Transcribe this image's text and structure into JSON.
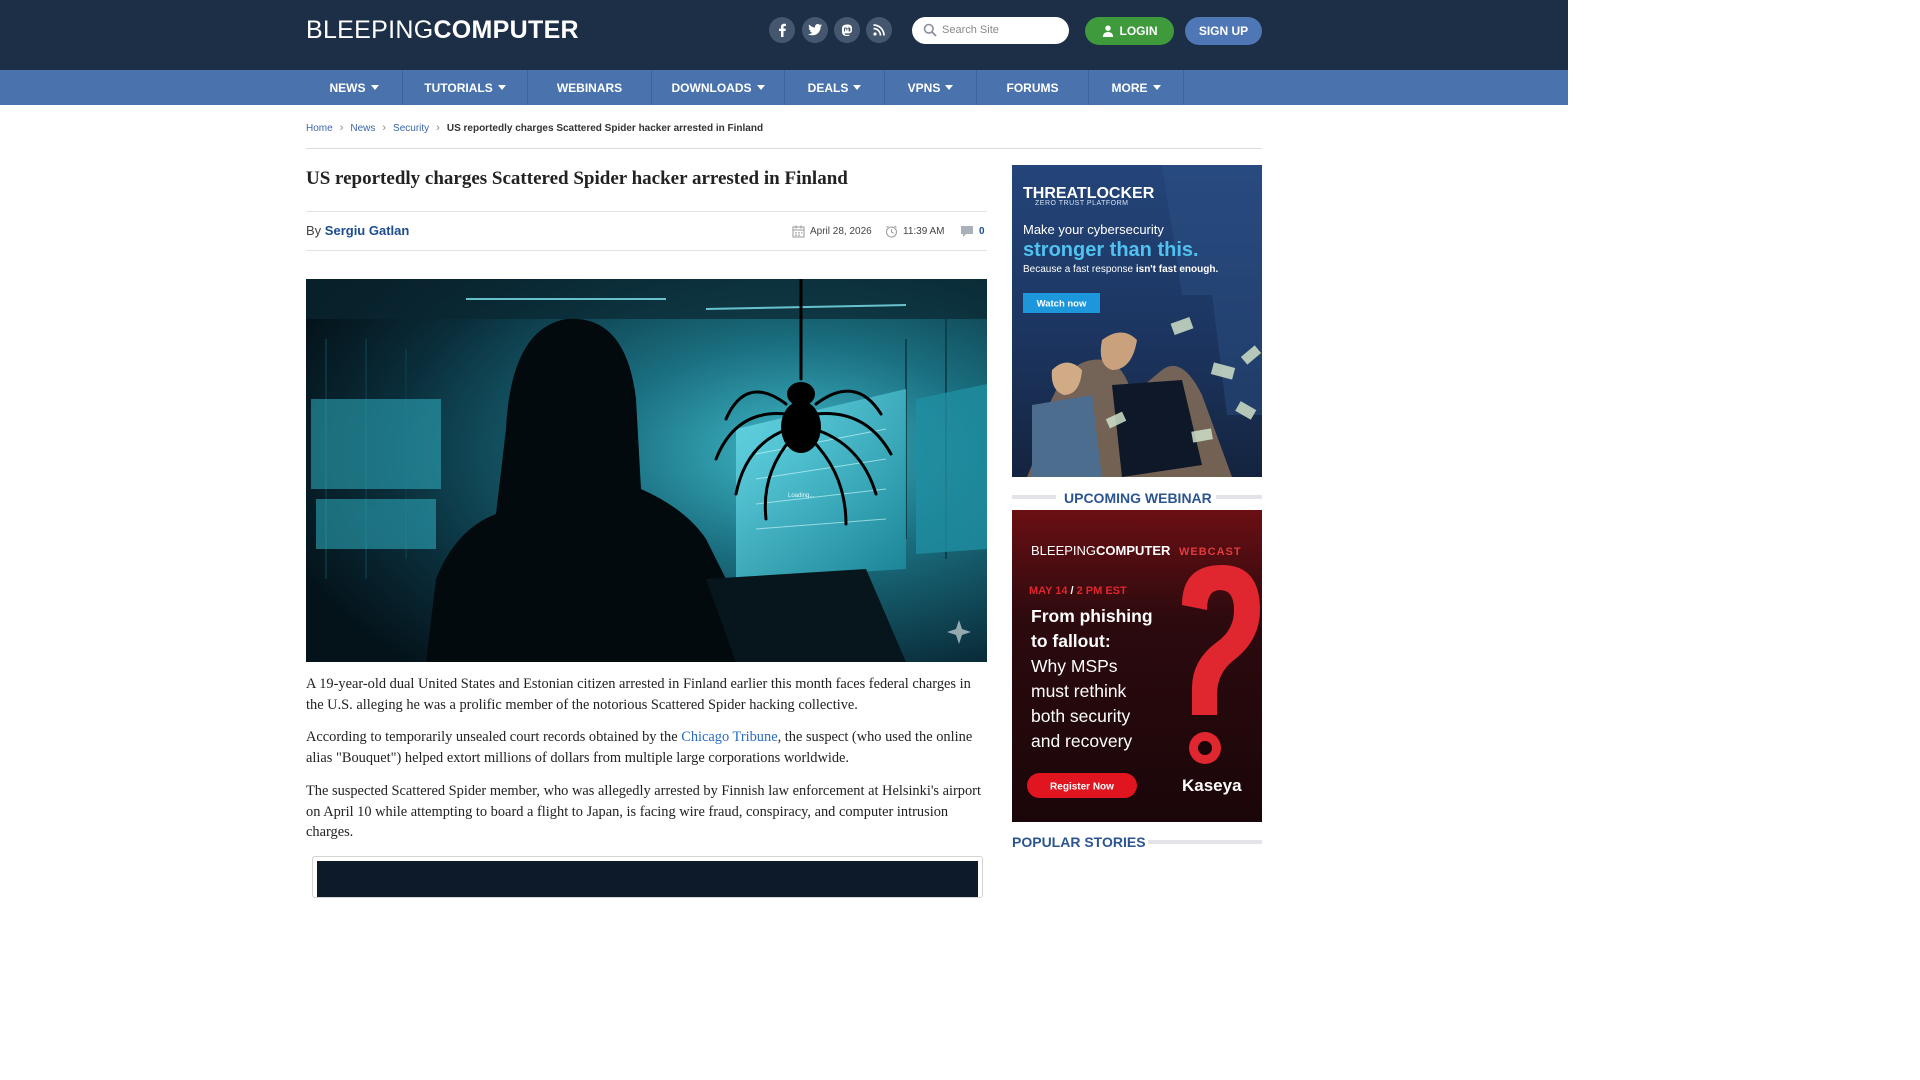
{
  "header": {
    "logo_part1": "BLEEPING",
    "logo_part2": "COMPUTER",
    "social_icons": [
      "facebook-icon",
      "twitter-icon",
      "mastodon-icon",
      "rss-icon"
    ],
    "search_placeholder": "Search Site",
    "login_label": "LOGIN",
    "signup_label": "SIGN UP"
  },
  "nav": {
    "items": [
      {
        "label": "NEWS",
        "dropdown": true
      },
      {
        "label": "TUTORIALS",
        "dropdown": true
      },
      {
        "label": "WEBINARS",
        "dropdown": false
      },
      {
        "label": "DOWNLOADS",
        "dropdown": true
      },
      {
        "label": "DEALS",
        "dropdown": true
      },
      {
        "label": "VPNS",
        "dropdown": true
      },
      {
        "label": "FORUMS",
        "dropdown": false
      },
      {
        "label": "MORE",
        "dropdown": true
      }
    ]
  },
  "breadcrumb": [
    "Home",
    "News",
    "Security",
    "US reportedly charges Scattered Spider hacker arrested in Finland"
  ],
  "article": {
    "title": "US reportedly charges Scattered Spider hacker arrested in Finland",
    "by": "By",
    "author": "Sergiu Gatlan",
    "date": "April 28, 2026",
    "time": "11:39 AM",
    "comments": "0",
    "hero_loading_text": "Loading...",
    "paragraph1": "A 19-year-old dual United States and Estonian citizen arrested in Finland earlier this month faces federal charges in the U.S. alleging he was a prolific member of the notorious Scattered Spider hacking collective.",
    "paragraph2_before": "According to temporarily unsealed court records obtained by the ",
    "paragraph2_link": "Chicago Tribune",
    "paragraph2_after": ", the suspect (who used the online alias \"Bouquet\") helped extort millions of dollars from multiple large corporations worldwide.",
    "paragraph3": "The suspected Scattered Spider member, who was allegedly arrested by Finnish law enforcement at Helsinki's airport on April 10 while attempting to board a flight to Japan, is facing wire fraud, conspiracy, and computer intrusion charges."
  },
  "sidebar": {
    "ad1": {
      "brand": "THREATLOCKER",
      "brand_sub": "ZERO TRUST PLATFORM",
      "line1": "Make your cybersecurity",
      "line2": "stronger than this.",
      "line3_a": "Because a fast response ",
      "line3_b": "isn't fast enough.",
      "cta": "Watch now"
    },
    "upcoming_webinar_heading": "UPCOMING WEBINAR",
    "ad2": {
      "brand_a": "BLEEPING",
      "brand_b": "COMPUTER",
      "brand_tag": "WEBCAST",
      "date": "MAY 14",
      "slash": "/",
      "time": "2 PM EST",
      "headline1": "From phishing",
      "headline2": "to fallout:",
      "body1": "Why MSPs",
      "body2": "must rethink",
      "body3": "both security",
      "body4": "and recovery",
      "cta": "Register Now",
      "sponsor": "Kaseya"
    },
    "popular_heading": "POPULAR STORIES"
  },
  "colors": {
    "header_bg": "#1d2e47",
    "nav_bg": "#4a73ad",
    "login_green": "#3f9a3c",
    "signup_blue": "#4f77b6",
    "link_blue": "#2a6cc2",
    "heading_blue": "#2c5590"
  }
}
